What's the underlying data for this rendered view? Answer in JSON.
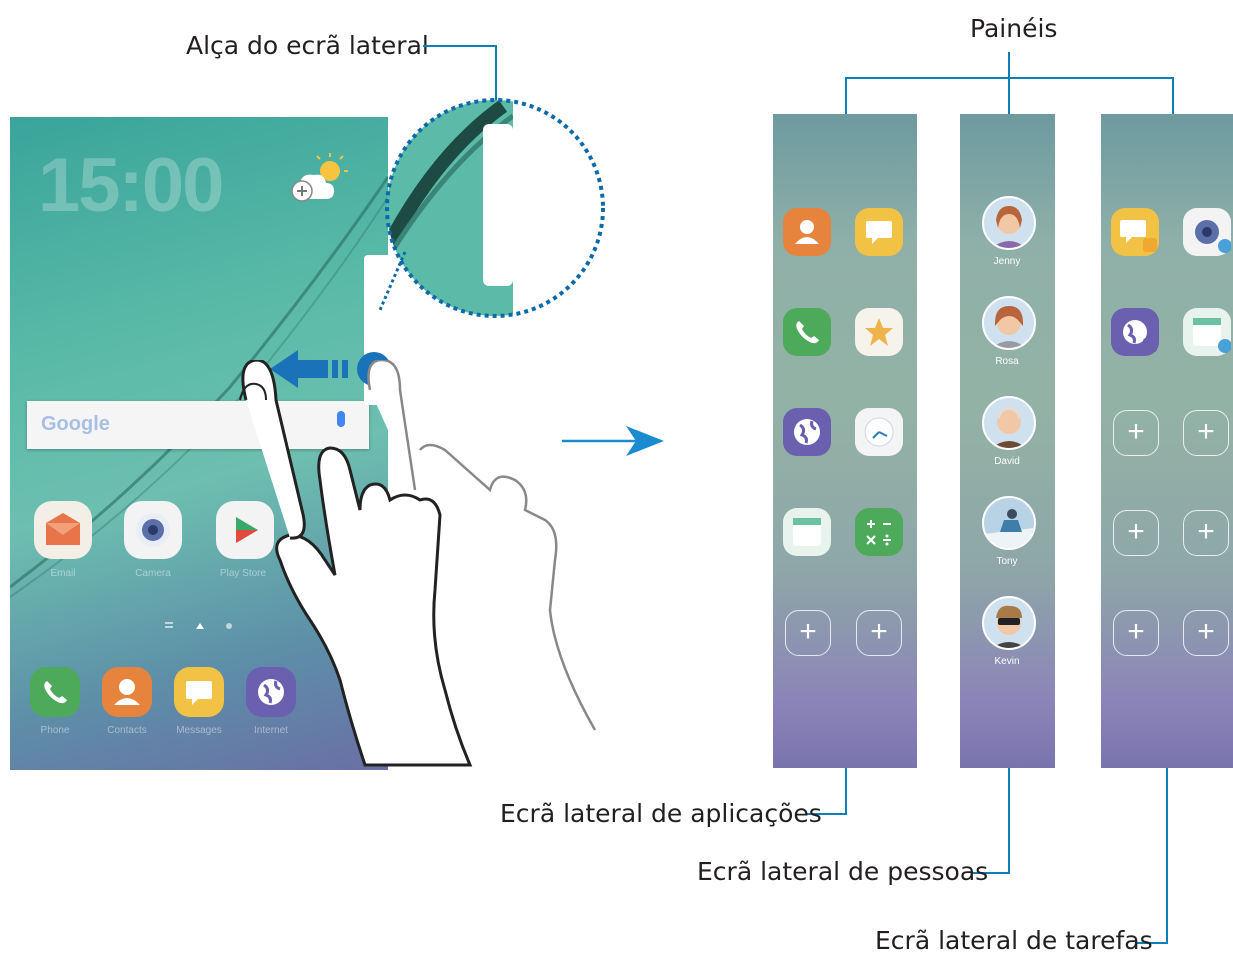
{
  "callouts": {
    "handle_label": "Alça do ecrã lateral",
    "panels_label": "Painéis",
    "apps_edge_label": "Ecrã lateral de aplicações",
    "people_edge_label": "Ecrã lateral de pessoas",
    "tasks_edge_label": "Ecrã lateral de tarefas"
  },
  "phone": {
    "clock": "15:00",
    "search_logo": "Google",
    "apps": [
      "Email",
      "Camera",
      "Play Store"
    ],
    "dock": [
      "Phone",
      "Contacts",
      "Messages",
      "Internet"
    ]
  },
  "people_panel": {
    "contacts": [
      "Jenny",
      "Rosa",
      "David",
      "Tony",
      "Kevin"
    ]
  },
  "plus_glyph": "+",
  "colors": {
    "callout_line": "#0a7fb8",
    "arrow": "#1a8bd0"
  }
}
